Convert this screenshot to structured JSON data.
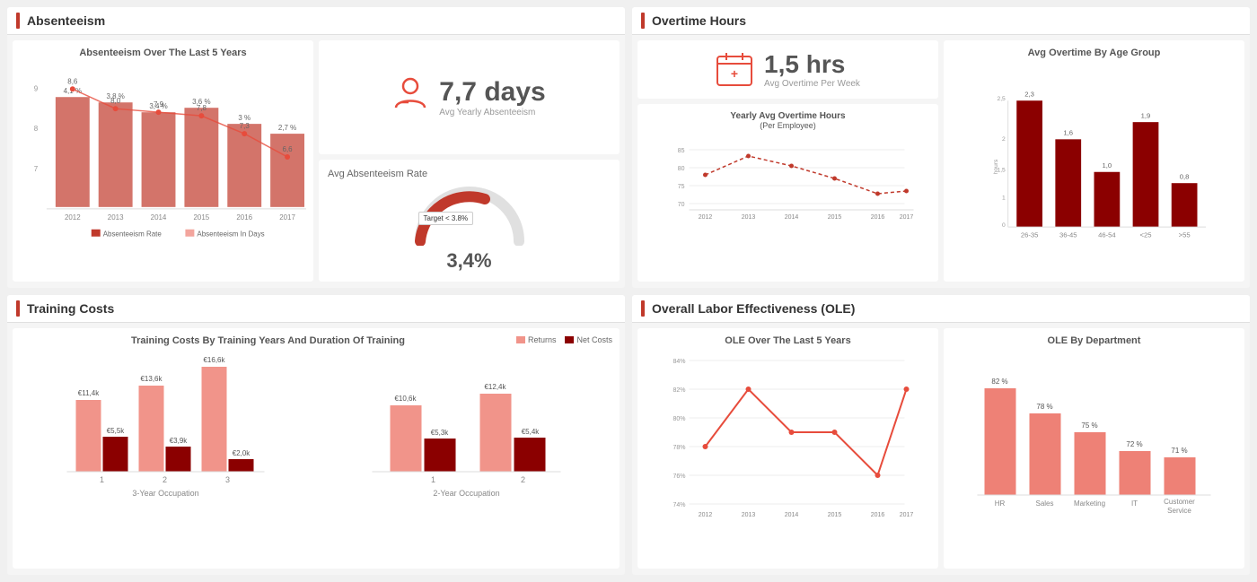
{
  "sections": {
    "absenteeism": {
      "title": "Absenteeism",
      "avg_stat": {
        "value": "7,7 days",
        "label": "Avg Yearly Absenteeism"
      },
      "avg_rate": {
        "title": "Avg Absenteeism Rate",
        "target": "Target < 3.8%",
        "value": "3,4%"
      },
      "line_chart": {
        "title": "Absenteeism Over The Last 5 Years",
        "years": [
          "2012",
          "2013",
          "2014",
          "2015",
          "2016",
          "2017"
        ],
        "line_values": [
          8.6,
          8.0,
          7.9,
          7.8,
          7.3,
          6.6
        ],
        "bar_values": [
          4.1,
          3.8,
          3.4,
          3.6,
          3.0,
          2.7
        ],
        "legend_rate": "Absenteeism Rate",
        "legend_days": "Absenteeism In Days"
      }
    },
    "overtime": {
      "title": "Overtime Hours",
      "avg_stat": {
        "value": "1,5 hrs",
        "label": "Avg Overtime Per Week"
      },
      "line_chart": {
        "title": "Yearly Avg Overtime Hours",
        "subtitle": "(Per Employee)",
        "years": [
          "2012",
          "2013",
          "2014",
          "2015",
          "2016",
          "2017"
        ],
        "values": [
          79,
          85,
          82,
          78,
          73,
          74
        ],
        "y_labels": [
          "85",
          "80",
          "75",
          "70"
        ]
      },
      "bar_chart": {
        "title": "Avg Overtime By Age Group",
        "groups": [
          "26-35",
          "36-45",
          "46-54",
          "<25",
          ">55"
        ],
        "values": [
          2.3,
          1.6,
          1.0,
          1.9,
          0.8
        ],
        "y_label": "hours"
      }
    },
    "training": {
      "title": "Training Costs",
      "chart_title": "Training Costs By Training Years And Duration Of Training",
      "three_year": {
        "subtitle": "3-Year Occupation",
        "groups": [
          "1",
          "2",
          "3"
        ],
        "returns": [
          11400,
          13600,
          16600
        ],
        "net_costs": [
          5500,
          3900,
          2000
        ],
        "returns_labels": [
          "€11,4k",
          "€13,6k",
          "€16,6k"
        ],
        "net_labels": [
          "€5,5k",
          "€3,9k",
          "€2,0k"
        ]
      },
      "two_year": {
        "subtitle": "2-Year Occupation",
        "groups": [
          "1",
          "2"
        ],
        "returns": [
          10600,
          12400
        ],
        "net_costs": [
          5300,
          5400
        ],
        "returns_labels": [
          "€10,6k",
          "€12,4k"
        ],
        "net_labels": [
          "€5,3k",
          "€5,4k"
        ]
      },
      "legend_returns": "Returns",
      "legend_net": "Net Costs"
    },
    "ole": {
      "title": "Overall Labor Effectiveness (OLE)",
      "line_chart": {
        "title": "OLE Over The Last 5 Years",
        "years": [
          "2012",
          "2013",
          "2014",
          "2015",
          "2016",
          "2017"
        ],
        "values": [
          78,
          82,
          79,
          79,
          76,
          82
        ],
        "y_labels": [
          "84%",
          "82%",
          "80%",
          "78%",
          "76%",
          "74%"
        ]
      },
      "bar_chart": {
        "title": "OLE By Department",
        "departments": [
          "HR",
          "Sales",
          "Marketing",
          "IT",
          "Customer\nService"
        ],
        "values": [
          82,
          78,
          75,
          72,
          71
        ],
        "labels": [
          "82 %",
          "78 %",
          "75 %",
          "72 %",
          "71 %"
        ]
      }
    }
  }
}
